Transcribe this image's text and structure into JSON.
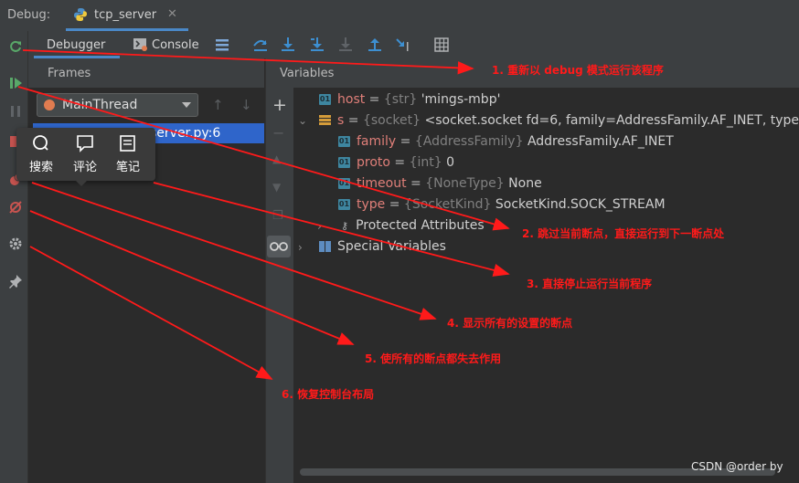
{
  "app": {
    "debug_label": "Debug:",
    "run_tab": "tcp_server"
  },
  "toolbar": {
    "debugger_tab": "Debugger",
    "console_tab": "Console"
  },
  "frames": {
    "title": "Frames",
    "thread": "MainThread",
    "selected_frame": "<module>, tcp_server.py:6",
    "frame_visible_text": "server.py:6"
  },
  "popup": {
    "search": "搜索",
    "comment": "评论",
    "note": "笔记"
  },
  "variables": {
    "title": "Variables",
    "rows": [
      {
        "name": "host",
        "type": "{str}",
        "value": "'mings-mbp'"
      },
      {
        "name": "s",
        "type": "{socket}",
        "value": "<socket.socket fd=6, family=AddressFamily.AF_INET, type="
      },
      {
        "name": "family",
        "type": "{AddressFamily}",
        "value": "AddressFamily.AF_INET"
      },
      {
        "name": "proto",
        "type": "{int}",
        "value": "0"
      },
      {
        "name": "timeout",
        "type": "{NoneType}",
        "value": "None"
      },
      {
        "name": "type",
        "type": "{SocketKind}",
        "value": "SocketKind.SOCK_STREAM"
      }
    ],
    "protected": "Protected Attributes",
    "special": "Special Variables",
    "badge": "01"
  },
  "annotations": [
    "1. 重新以 debug 模式运行该程序",
    "2. 跳过当前断点，直接运行到下一断点处",
    "3. 直接停止运行当前程序",
    "4. 显示所有的设置的断点",
    "5. 使所有的断点都失去作用",
    "6. 恢复控制台布局"
  ],
  "watermark": "CSDN @order by",
  "colors": {
    "annotation": "#ff1a1a",
    "accent": "#4a88c7",
    "selection": "#2f65ca",
    "var_name": "#e07f79"
  },
  "icons": [
    "rerun-icon",
    "resume-icon",
    "pause-icon",
    "stop-icon",
    "view-breakpoints-icon",
    "mute-breakpoints-icon",
    "settings-icon",
    "pin-icon",
    "python-icon",
    "console-icon",
    "step-over-icon",
    "step-into-icon",
    "step-into-my-code-icon",
    "force-step-into-icon",
    "step-out-icon",
    "run-to-cursor-icon",
    "evaluate-icon",
    "add-watch-icon",
    "glasses-icon",
    "search-icon",
    "comment-icon",
    "note-icon"
  ]
}
